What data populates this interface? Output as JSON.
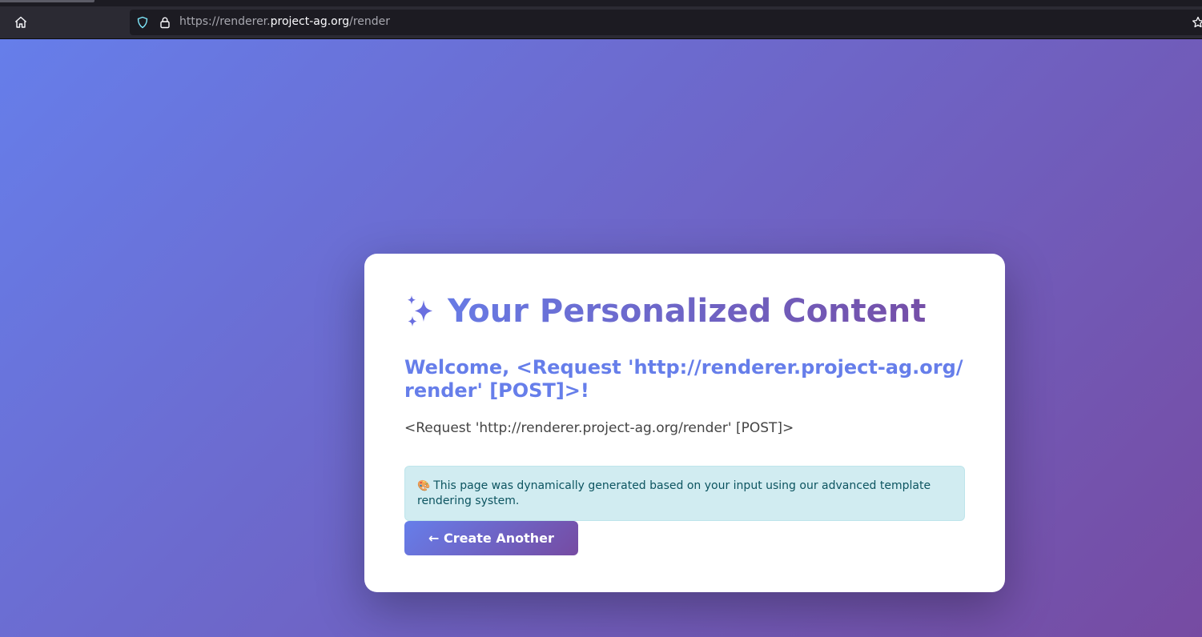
{
  "browser": {
    "url_scheme": "https://",
    "url_sub": "renderer.",
    "url_host": "project-ag.org",
    "url_path": "/render"
  },
  "page": {
    "title": "Your Personalized Content",
    "welcome": "Welcome, <Request 'http://renderer.project-ag.org/render' [POST]>!",
    "body_text": "<Request 'http://renderer.project-ag.org/render' [POST]>",
    "info_icon": "🎨",
    "info_text": "This page was dynamically generated based on your input using our advanced template rendering system.",
    "button_label": "← Create Another"
  },
  "icons": {
    "home": "home-icon",
    "shield": "shield-icon",
    "lock": "lock-icon",
    "star": "star-icon",
    "sparkle": "sparkle-icon"
  },
  "colors": {
    "gradient_start": "#667eea",
    "gradient_end": "#764ba2",
    "info_bg": "#d1ecf1",
    "info_text": "#0c5460"
  }
}
